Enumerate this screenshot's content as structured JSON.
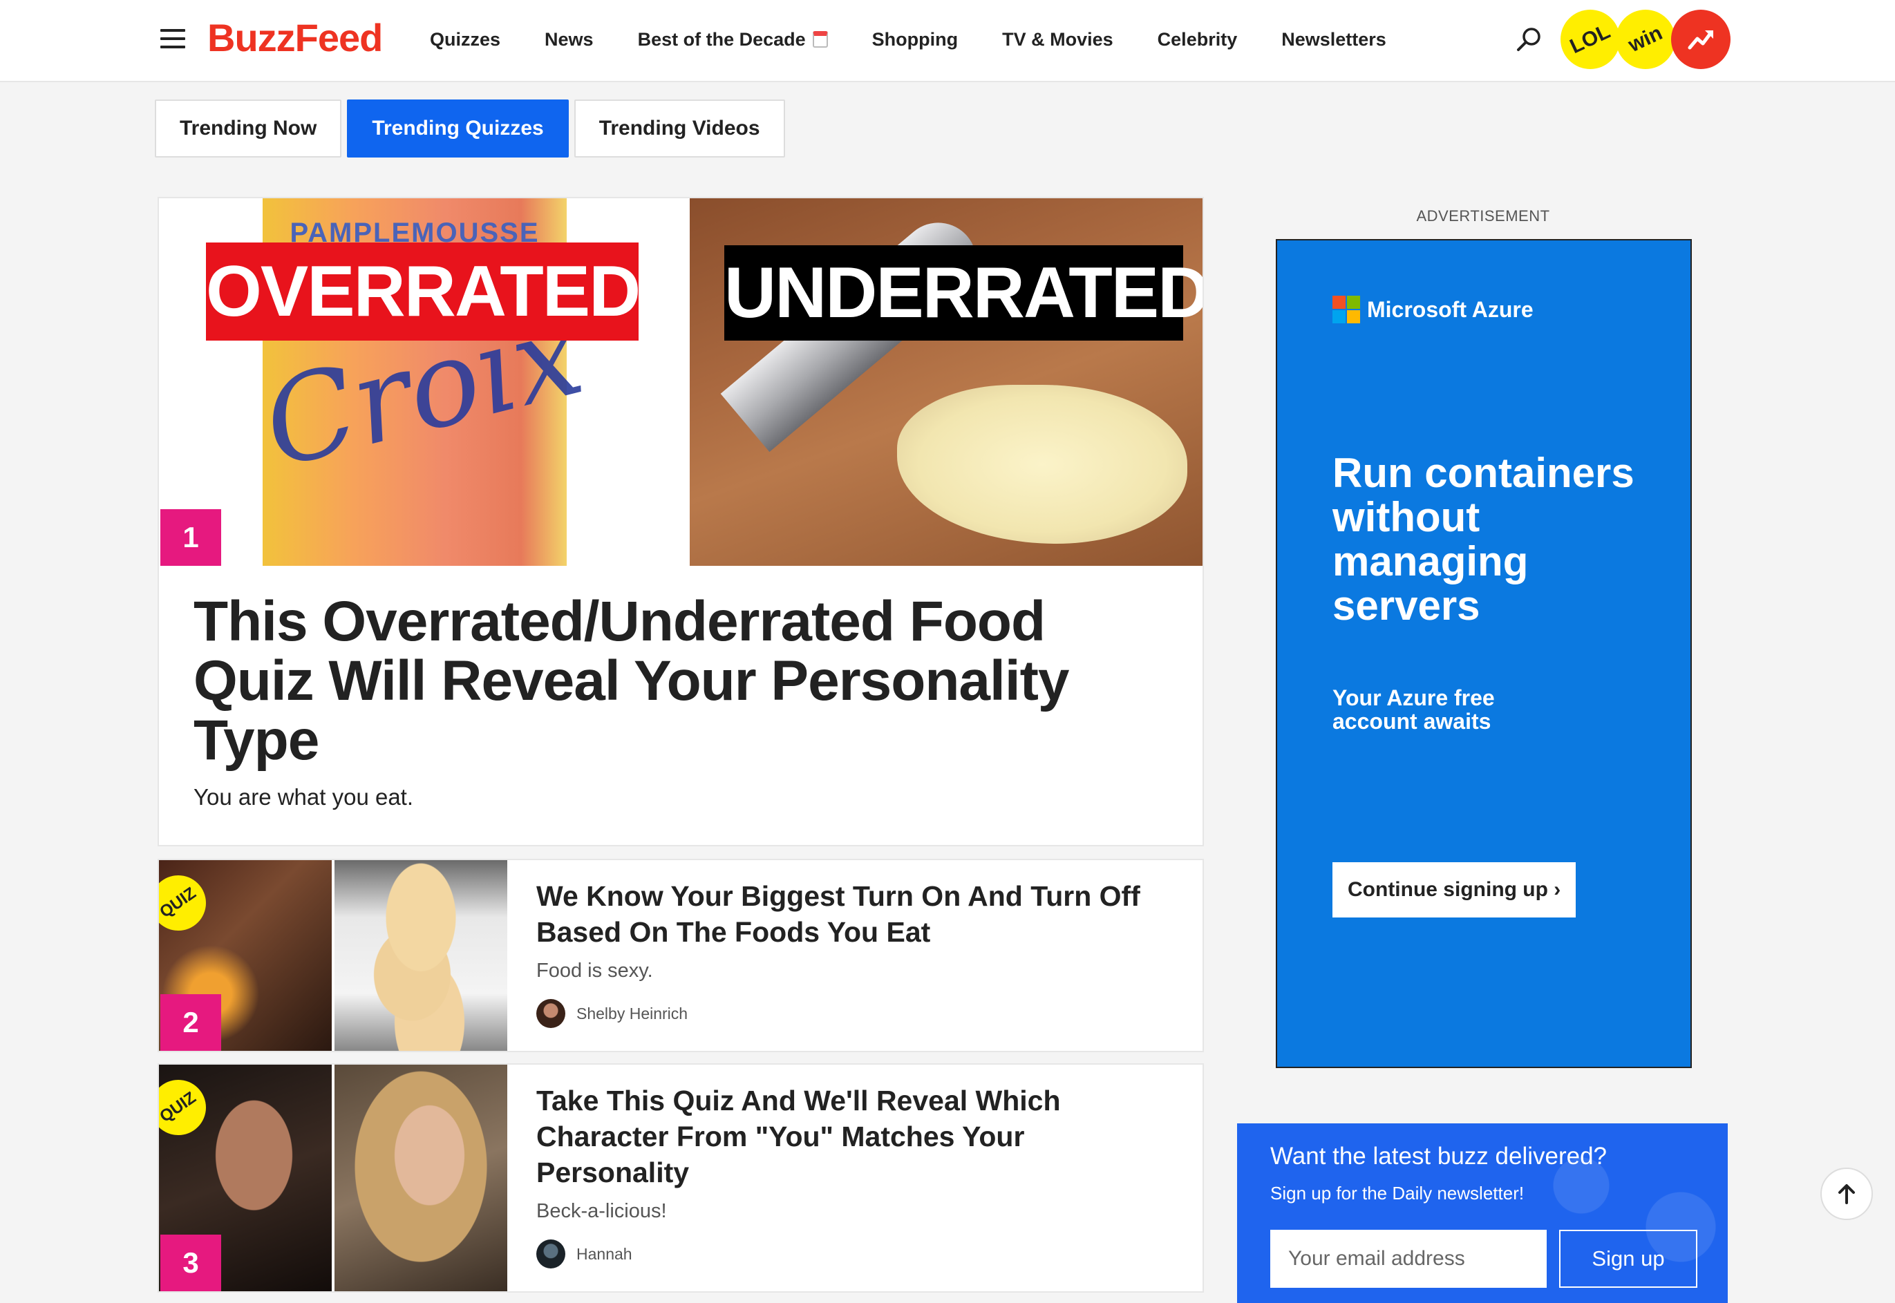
{
  "header": {
    "logo": "BuzzFeed",
    "nav": [
      "Quizzes",
      "News",
      "Best of the Decade",
      "Shopping",
      "TV & Movies",
      "Celebrity",
      "Newsletters"
    ],
    "badges": {
      "lol": "LOL",
      "win": "win"
    }
  },
  "tabs": [
    "Trending Now",
    "Trending Quizzes",
    "Trending Videos"
  ],
  "active_tab": "Trending Quizzes",
  "feature": {
    "rank": "1",
    "label_left": "OVERRATED",
    "label_right": "UNDERRATED",
    "can_text": "PAMPLEMOUSSE",
    "title": "This Overrated/Underrated Food Quiz Will Reveal Your Personality Type",
    "subtitle": "You are what you eat."
  },
  "cards": [
    {
      "rank": "2",
      "badge": "QUIZ",
      "title": "We Know Your Biggest Turn On And Turn Off Based On The Foods You Eat",
      "subtitle": "Food is sexy.",
      "author": "Shelby Heinrich"
    },
    {
      "rank": "3",
      "badge": "QUIZ",
      "title": "Take This Quiz And We'll Reveal Which Character From \"You\" Matches Your Personality",
      "subtitle": "Beck-a-licious!",
      "author": "Hannah"
    }
  ],
  "ad": {
    "label": "ADVERTISEMENT",
    "brand": "Microsoft Azure",
    "headline": "Run containers without managing servers",
    "subline": "Your Azure free account awaits",
    "cta": "Continue signing up ›"
  },
  "newsletter": {
    "title": "Want the latest buzz delivered?",
    "subtitle": "Sign up for the Daily newsletter!",
    "placeholder": "Your email address",
    "button": "Sign up"
  },
  "colors": {
    "brand": "#ee3322",
    "active_tab": "#0f65ef",
    "rank": "#e6197f",
    "badge_yellow": "#ffee00",
    "ad_blue": "#0b79e0",
    "newsletter_blue": "#1f64ee"
  },
  "icons": [
    "hamburger-icon",
    "calendar-icon",
    "search-icon",
    "trending-arrow-icon",
    "arrow-up-icon"
  ]
}
